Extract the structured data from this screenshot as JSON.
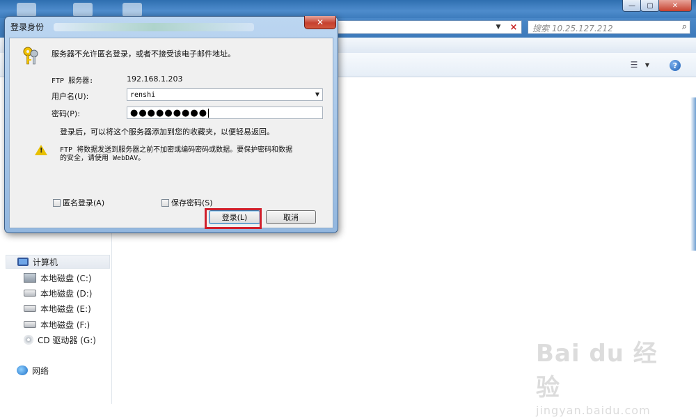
{
  "explorer": {
    "search_placeholder": "搜索 10.25.127.212",
    "nav": {
      "computer": "计算机",
      "drives": [
        "本地磁盘 (C:)",
        "本地磁盘 (D:)",
        "本地磁盘 (E:)",
        "本地磁盘 (F:)",
        "CD 驱动器 (G:)"
      ],
      "network": "网络"
    },
    "icons": {
      "stop": "×",
      "search": "⌕",
      "help": "?"
    }
  },
  "dialog": {
    "title": "登录身份",
    "close_label": "✕",
    "message": "服务器不允许匿名登录，或者不接受该电子邮件地址。",
    "ftp_server_label": "FTP 服务器:",
    "ftp_server_value": "192.168.1.203",
    "username_label": "用户名(U):",
    "username_value": "renshi",
    "password_label": "密码(P):",
    "password_value": "●●●●●●●●●",
    "info": "登录后，可以将这个服务器添加到您的收藏夹，以便轻易返回。",
    "warning_line1": "FTP 将数据发送到服务器之前不加密或编码密码或数据。要保护密码和数据",
    "warning_line2": "的安全，请使用 WebDAV。",
    "anonymous_label": "匿名登录(A)",
    "save_password_label": "保存密码(S)",
    "login_button": "登录(L)",
    "cancel_button": "取消"
  },
  "watermark": {
    "logo": "Bai du 经验",
    "url": "jingyan.baidu.com"
  },
  "colors": {
    "highlight": "#d0202c",
    "dialog_frame": "#93b7df",
    "warning": "#e8c000"
  }
}
